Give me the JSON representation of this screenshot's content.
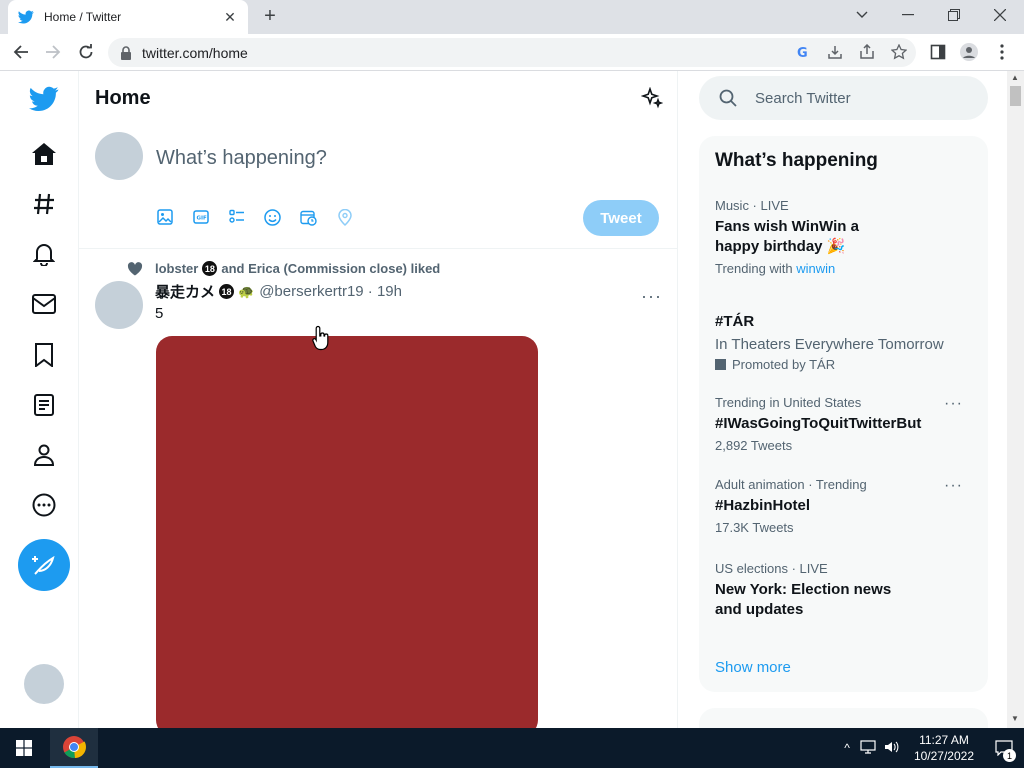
{
  "browser": {
    "tab_title": "Home / Twitter",
    "url": "twitter.com/home"
  },
  "main": {
    "title": "Home",
    "composer_placeholder": "What’s happening?",
    "tweet_button": "Tweet"
  },
  "tweet": {
    "social_context_name1": "lobster",
    "social_context_rest": "and Erica (Commission close) liked",
    "author_name": "暴走カメ",
    "badge": "18",
    "handle_time": "@berserkertr19 · 19h",
    "text": "5"
  },
  "search": {
    "placeholder": "Search Twitter"
  },
  "trends": {
    "title": "What’s happening",
    "items": [
      {
        "meta": "Music · LIVE",
        "title_line1": "Fans wish WinWin a",
        "title_line2": "happy birthday",
        "sub_prefix": "Trending with",
        "sub_link": "winwin"
      },
      {
        "title": "#TÁR",
        "desc": "In Theaters Everywhere Tomorrow",
        "promo": "Promoted by TÁR"
      },
      {
        "meta": "Trending in United States",
        "title": "#IWasGoingToQuitTwitterBut",
        "sub": "2,892 Tweets"
      },
      {
        "meta": "Adult animation · Trending",
        "title": "#HazbinHotel",
        "sub": "17.3K Tweets"
      },
      {
        "meta": "US elections · LIVE",
        "title_line1": "New York: Election news",
        "title_line2": "and updates"
      }
    ],
    "show_more": "Show more"
  },
  "taskbar": {
    "time": "11:27 AM",
    "date": "10/27/2022",
    "notifications": "1"
  },
  "colors": {
    "twitter_blue": "#1d9bf0",
    "media_red": "#9b2a2c"
  }
}
